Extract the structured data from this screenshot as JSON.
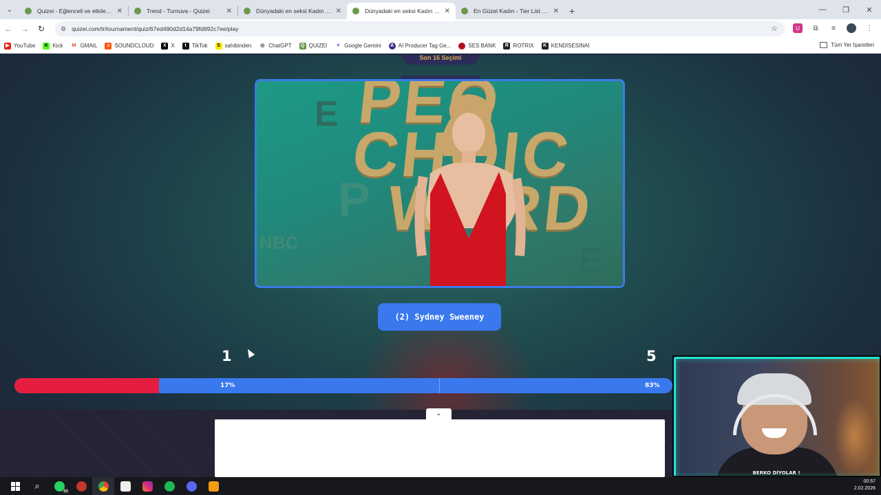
{
  "browser": {
    "tabs": [
      {
        "title": "Quizei - Eğlenceli ve etkileşimli",
        "active": false
      },
      {
        "title": "Trend - Turnuva - Quizei",
        "active": false
      },
      {
        "title": "Dünyadaki en seksi Kadın kim",
        "active": false
      },
      {
        "title": "Dünyadaki en seksi Kadın kim",
        "active": true
      },
      {
        "title": "En Güzel Kadın - Tier List | Kör",
        "active": false
      }
    ],
    "new_tab": "+",
    "url": "quizei.com/tr/tournament/quiz/67ed490d2d14a79fd992c7ee/play",
    "bookmarks": [
      {
        "label": "YouTube",
        "color": "#e62117",
        "glyph": "▶"
      },
      {
        "label": "Kick",
        "color": "#53fc18",
        "glyph": "K"
      },
      {
        "label": "GMAIL",
        "color": "#ea4335",
        "glyph": "M"
      },
      {
        "label": "SOUNDCLOUD",
        "color": "#ff5500",
        "glyph": "s"
      },
      {
        "label": "X",
        "color": "#000000",
        "glyph": "X"
      },
      {
        "label": "TikTok",
        "color": "#111111",
        "glyph": "t"
      },
      {
        "label": "sahibinden",
        "color": "#ffe800",
        "glyph": "S"
      },
      {
        "label": "ChatGPT",
        "color": "#555555",
        "glyph": "◎"
      },
      {
        "label": "QUIZEI",
        "color": "#6a9a4a",
        "glyph": "Q"
      },
      {
        "label": "Google Gemini",
        "color": "#5a7fe0",
        "glyph": "✦"
      },
      {
        "label": "AI Producer Tag Ge...",
        "color": "#3a2a8a",
        "glyph": "A"
      },
      {
        "label": "SES BANK",
        "color": "#b0101a",
        "glyph": "●"
      },
      {
        "label": "ROTRIX",
        "color": "#222222",
        "glyph": "R"
      },
      {
        "label": "KENDİSESİNAI",
        "color": "#222222",
        "glyph": "K"
      }
    ],
    "bookmarks_folder": "Tüm Yer İşaretleri"
  },
  "quiz": {
    "round_label": "Son 16 Seçimi",
    "contestant_name": "(2) Sydney Sweeney",
    "photo_backdrop_text": "PEOPLE'S CHOICE AWARDS",
    "photo_logo_text": "NBC",
    "votes_left": "1",
    "votes_right": "5",
    "percent_left": "17%",
    "percent_right": "83%",
    "percent_left_value": 0.17,
    "colors": {
      "left": "#e51e40",
      "right": "#3a78ee"
    }
  },
  "stream_overlay": {
    "streamer_label": "BERKO DİYOLAR !"
  },
  "taskbar": {
    "whatsapp_badge": "60",
    "date": "2.02.2026",
    "time": "00:57"
  }
}
